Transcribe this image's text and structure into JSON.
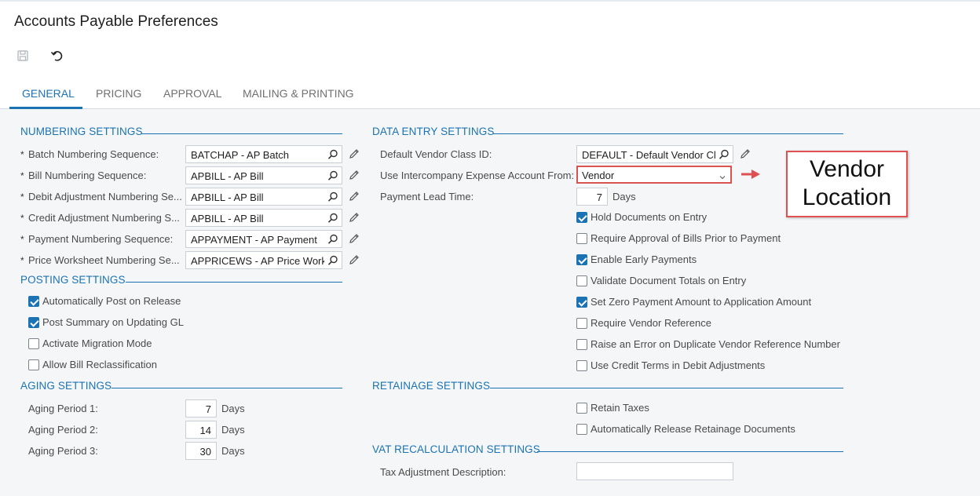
{
  "page": {
    "title": "Accounts Payable Preferences"
  },
  "toolbar": {
    "save_icon": "save-icon",
    "undo_icon": "undo-icon"
  },
  "tabs": [
    {
      "label": "GENERAL",
      "active": true
    },
    {
      "label": "PRICING",
      "active": false
    },
    {
      "label": "APPROVAL",
      "active": false
    },
    {
      "label": "MAILING & PRINTING",
      "active": false
    }
  ],
  "numbering": {
    "header": "NUMBERING SETTINGS",
    "rows": [
      {
        "label": "Batch Numbering Sequence:",
        "value": "BATCHAP - AP Batch"
      },
      {
        "label": "Bill Numbering Sequence:",
        "value": "APBILL - AP Bill"
      },
      {
        "label": "Debit Adjustment Numbering Se...",
        "value": "APBILL - AP Bill"
      },
      {
        "label": "Credit Adjustment Numbering S...",
        "value": "APBILL - AP Bill"
      },
      {
        "label": "Payment Numbering Sequence:",
        "value": "APPAYMENT - AP Payment"
      },
      {
        "label": "Price Worksheet Numbering Se...",
        "value": "APPRICEWS - AP Price Works"
      }
    ]
  },
  "posting": {
    "header": "POSTING SETTINGS",
    "items": [
      {
        "label": "Automatically Post on Release",
        "checked": true
      },
      {
        "label": "Post Summary on Updating GL",
        "checked": true
      },
      {
        "label": "Activate Migration Mode",
        "checked": false
      },
      {
        "label": "Allow Bill Reclassification",
        "checked": false
      }
    ]
  },
  "aging": {
    "header": "AGING SETTINGS",
    "rows": [
      {
        "label": "Aging Period 1:",
        "value": "7",
        "unit": "Days"
      },
      {
        "label": "Aging Period 2:",
        "value": "14",
        "unit": "Days"
      },
      {
        "label": "Aging Period 3:",
        "value": "30",
        "unit": "Days"
      }
    ]
  },
  "data_entry": {
    "header": "DATA ENTRY SETTINGS",
    "vendor_class_label": "Default Vendor Class ID:",
    "vendor_class_value": "DEFAULT - Default Vendor Cl",
    "intercompany_label": "Use Intercompany Expense Account From:",
    "intercompany_value": "Vendor",
    "lead_time_label": "Payment Lead Time:",
    "lead_time_value": "7",
    "lead_time_unit": "Days",
    "items": [
      {
        "label": "Hold Documents on Entry",
        "checked": true
      },
      {
        "label": "Require Approval of Bills Prior to Payment",
        "checked": false
      },
      {
        "label": "Enable Early Payments",
        "checked": true
      },
      {
        "label": "Validate Document Totals on Entry",
        "checked": false
      },
      {
        "label": "Set Zero Payment Amount to Application Amount",
        "checked": true
      },
      {
        "label": "Require Vendor Reference",
        "checked": false
      },
      {
        "label": "Raise an Error on Duplicate Vendor Reference Number",
        "checked": false
      },
      {
        "label": "Use Credit Terms in Debit Adjustments",
        "checked": false
      }
    ]
  },
  "retainage": {
    "header": "RETAINAGE SETTINGS",
    "items": [
      {
        "label": "Retain Taxes",
        "checked": false
      },
      {
        "label": "Automatically Release Retainage Documents",
        "checked": false
      }
    ]
  },
  "vat": {
    "header": "VAT RECALCULATION SETTINGS",
    "tax_desc_label": "Tax Adjustment Description:",
    "tax_desc_value": ""
  },
  "annotation": {
    "line1": "Vendor",
    "line2": "Location",
    "color": "#e05050"
  },
  "colors": {
    "accent": "#1b73b3",
    "panel": "#f4f6f8"
  }
}
